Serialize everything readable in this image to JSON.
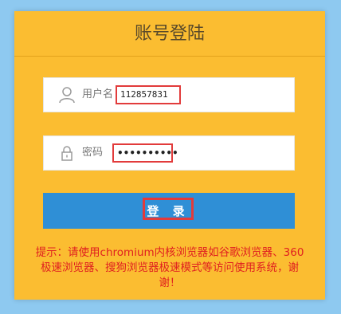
{
  "page": {
    "title": "账号登陆"
  },
  "form": {
    "username_label": "用户名",
    "username_value": "112857831",
    "password_label": "密码",
    "password_value": "••••••••••",
    "submit_label": "登 录"
  },
  "notice": {
    "text": "提示：请使用chromium内核浏览器如谷歌浏览器、360极速浏览器、搜狗浏览器极速模式等访问使用系统，谢谢！"
  },
  "icons": {
    "user": "user-icon",
    "lock": "lock-icon"
  },
  "colors": {
    "background": "#8ec9f0",
    "panel": "#fbbd31",
    "button": "#2f8fd6",
    "highlight": "#e23b3b",
    "notice": "#e02020"
  }
}
